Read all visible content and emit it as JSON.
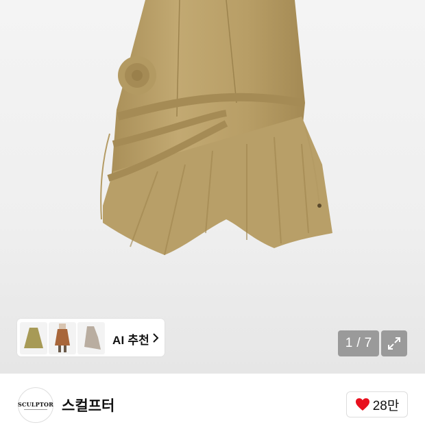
{
  "gallery": {
    "current_page": "1",
    "separator": "/",
    "total_pages": "7"
  },
  "ai_recommend": {
    "label": "AI 추천",
    "thumbnails": [
      "skirt-thumb-khaki",
      "skirt-thumb-brown-model",
      "skirt-thumb-grey"
    ]
  },
  "brand": {
    "logo_text": "SCULPTOR",
    "name": "스컬프터"
  },
  "like": {
    "count": "28만",
    "icon": "heart-icon",
    "color": "#e8101e"
  },
  "colors": {
    "skirt": "#bea56e",
    "skirt_shadow": "#a98f58",
    "overlay": "#8c8c8c"
  }
}
